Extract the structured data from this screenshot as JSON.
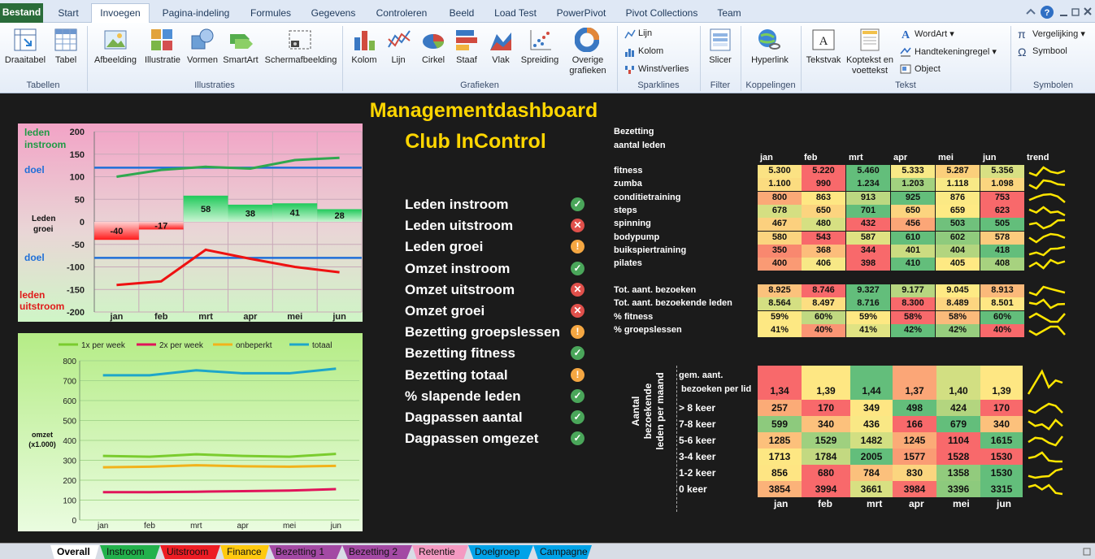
{
  "tabs": [
    "Bestand",
    "Start",
    "Invoegen",
    "Pagina-indeling",
    "Formules",
    "Gegevens",
    "Controleren",
    "Beeld",
    "Load Test",
    "PowerPivot",
    "Pivot Collections",
    "Team"
  ],
  "ribbon": {
    "buttons": [
      "Draaitabel",
      "Tabel",
      "Afbeelding",
      "Illustratie",
      "Vormen",
      "SmartArt",
      "Schermafbeelding",
      "Kolom",
      "Lijn",
      "Cirkel",
      "Staaf",
      "Vlak",
      "Spreiding",
      "Overige",
      "grafieken",
      "Slicer",
      "Hyperlink",
      "Tekstvak",
      "Koptekst en",
      "voettekst"
    ],
    "sparklines": [
      "Lijn",
      "Kolom",
      "Winst/verlies"
    ],
    "tekst_small": [
      "WordArt",
      "Handtekeningregel",
      "Object"
    ],
    "symbolen": [
      "Vergelijking",
      "Symbool"
    ],
    "groups": [
      "Tabellen",
      "Illustraties",
      "Grafieken",
      "Sparklines",
      "Filter",
      "Koppelingen",
      "Tekst",
      "Symbolen"
    ]
  },
  "dashboard": {
    "title1": "Managementdashboard",
    "title2": "Club InControl"
  },
  "kpis": [
    {
      "label": "Leden instroom",
      "status": "ok"
    },
    {
      "label": "Leden uitstroom",
      "status": "bad"
    },
    {
      "label": "Leden groei",
      "status": "warn"
    },
    {
      "label": "Omzet instroom",
      "status": "ok"
    },
    {
      "label": "Omzet uitstroom",
      "status": "bad"
    },
    {
      "label": "Omzet groei",
      "status": "bad"
    },
    {
      "label": "Bezetting groepslessen",
      "status": "warn"
    },
    {
      "label": "Bezetting fitness",
      "status": "ok"
    },
    {
      "label": "Bezetting totaal",
      "status": "warn"
    },
    {
      "label": "% slapende leden",
      "status": "ok"
    },
    {
      "label": "Dagpassen aantal",
      "status": "ok"
    },
    {
      "label": "Dagpassen omgezet",
      "status": "ok"
    }
  ],
  "chart_data": [
    {
      "type": "line",
      "categories": [
        "jan",
        "feb",
        "mrt",
        "apr",
        "mei",
        "jun"
      ],
      "labels": {
        "leden": "leden",
        "instroom": "instroom",
        "doel": "doel",
        "leden_groei_1": "Leden",
        "leden_groei_2": "groei",
        "uitstroom": "uitstroom"
      },
      "ylim": [
        -200,
        200
      ],
      "yticks": [
        "200",
        "150",
        "100",
        "50",
        "0",
        "-50",
        "-100",
        "-150",
        "-200"
      ],
      "series": [
        {
          "name": "leden instroom",
          "values": [
            100,
            115,
            122,
            118,
            137,
            142
          ]
        },
        {
          "name": "leden uitstroom",
          "values": [
            -140,
            -132,
            -62,
            -82,
            -100,
            -112
          ]
        },
        {
          "name": "doel",
          "values": [
            120,
            120,
            120,
            120,
            120,
            120
          ]
        },
        {
          "name": "doel",
          "values": [
            -80,
            -80,
            -80,
            -80,
            -80,
            -80
          ]
        },
        {
          "name": "groei",
          "values": [
            -40,
            -17,
            58,
            38,
            41,
            28
          ],
          "display": [
            "-40",
            "-17",
            "58",
            "38",
            "41",
            "28"
          ]
        }
      ],
      "colors": {
        "instroom": "#2fa84f",
        "uitstroom": "#ee1111",
        "doel": "#1f6fd8"
      }
    },
    {
      "type": "line",
      "categories": [
        "jan",
        "feb",
        "mrt",
        "apr",
        "mei",
        "jun"
      ],
      "ylabel": "omzet\n(x1.000)",
      "ylabel_lines": [
        "omzet",
        "(x1.000)"
      ],
      "ylim": [
        0,
        800
      ],
      "yticks": [
        "800",
        "700",
        "600",
        "500",
        "400",
        "300",
        "200",
        "100",
        "0"
      ],
      "series": [
        {
          "name": "1x per week",
          "values": [
            322,
            318,
            330,
            322,
            318,
            332
          ],
          "color": "#7acc2e"
        },
        {
          "name": "2x per week",
          "values": [
            140,
            140,
            142,
            145,
            148,
            155
          ],
          "color": "#e0145a"
        },
        {
          "name": "onbeperkt",
          "values": [
            265,
            268,
            275,
            270,
            268,
            272
          ],
          "color": "#f2b21b"
        },
        {
          "name": "totaal",
          "values": [
            727,
            727,
            752,
            737,
            737,
            760
          ],
          "color": "#1ea6c9"
        }
      ]
    },
    {
      "type": "table",
      "title1": "Bezetting",
      "title2": "aantal leden",
      "trend_header": "trend",
      "months": [
        "jan",
        "feb",
        "mrt",
        "apr",
        "mei",
        "jun"
      ],
      "rows": [
        {
          "label": "fitness",
          "values": [
            "5.300",
            "5.220",
            "5.460",
            "5.333",
            "5.287",
            "5.356"
          ],
          "colors": [
            "#fbe283",
            "#f8696b",
            "#63be7b",
            "#f8e986",
            "#fbcf7b",
            "#d8e083"
          ]
        },
        {
          "label": "zumba",
          "values": [
            "1.100",
            "990",
            "1.234",
            "1.203",
            "1.118",
            "1.098"
          ],
          "colors": [
            "#fbdc80",
            "#f8696b",
            "#63be7b",
            "#a2d17f",
            "#f8e986",
            "#fbd57f"
          ]
        },
        {
          "label": "conditietraining",
          "values": [
            "800",
            "863",
            "913",
            "925",
            "876",
            "753"
          ],
          "colors": [
            "#fba977",
            "#fee783",
            "#bcd881",
            "#63be7b",
            "#fbe984",
            "#f8696b"
          ]
        },
        {
          "label": "steps",
          "values": [
            "678",
            "650",
            "701",
            "650",
            "659",
            "623"
          ],
          "colors": [
            "#d5df82",
            "#fcd47f",
            "#63be7b",
            "#fcd47f",
            "#feea84",
            "#f8696b"
          ]
        },
        {
          "label": "spinning",
          "values": [
            "467",
            "480",
            "432",
            "456",
            "503",
            "505"
          ],
          "colors": [
            "#fcd07e",
            "#d6e082",
            "#f8696b",
            "#fba677",
            "#70c17c",
            "#63be7b"
          ]
        },
        {
          "label": "bodypump",
          "values": [
            "580",
            "543",
            "587",
            "610",
            "602",
            "578"
          ],
          "colors": [
            "#fbd47f",
            "#f8696b",
            "#dfe282",
            "#63be7b",
            "#8fcb7d",
            "#fbcb7d"
          ]
        },
        {
          "label": "buikspiertraining",
          "values": [
            "350",
            "368",
            "344",
            "401",
            "404",
            "418"
          ],
          "colors": [
            "#f9886f",
            "#fcbd7b",
            "#f8696b",
            "#cbdc81",
            "#b3d57f",
            "#63be7b"
          ]
        },
        {
          "label": "pilates",
          "values": [
            "400",
            "406",
            "398",
            "410",
            "405",
            "408"
          ],
          "colors": [
            "#fa9a74",
            "#f7e886",
            "#f8696b",
            "#63be7b",
            "#fee983",
            "#a7d27f"
          ]
        }
      ],
      "totals": [
        {
          "label": "Tot. aant.  bezoeken",
          "values": [
            "8.925",
            "8.746",
            "9.327",
            "9.177",
            "9.045",
            "8.913"
          ],
          "colors": [
            "#fbc27c",
            "#f8696b",
            "#63be7b",
            "#b7d680",
            "#feea84",
            "#fbb97a"
          ]
        },
        {
          "label": "Tot. aant. bezoekende leden",
          "values": [
            "8.564",
            "8.497",
            "8.716",
            "8.300",
            "8.489",
            "8.501"
          ],
          "colors": [
            "#d4df82",
            "#fcde81",
            "#63be7b",
            "#f8696b",
            "#fcd580",
            "#fee784"
          ]
        },
        {
          "label": "% fitness",
          "values": [
            "59%",
            "60%",
            "59%",
            "58%",
            "58%",
            "60%"
          ],
          "colors": [
            "#fde883",
            "#c0d981",
            "#fde883",
            "#f8696b",
            "#fbba7b",
            "#63be7b"
          ]
        },
        {
          "label": "% groepslessen",
          "values": [
            "41%",
            "40%",
            "41%",
            "42%",
            "42%",
            "40%"
          ],
          "colors": [
            "#fde883",
            "#fa9574",
            "#e0e383",
            "#63be7b",
            "#97cd7e",
            "#f8696b"
          ]
        }
      ]
    },
    {
      "type": "table",
      "side_label": [
        "Aantal",
        "bezoekende",
        "leden per maand"
      ],
      "months": [
        "jan",
        "feb",
        "mrt",
        "apr",
        "mei",
        "jun"
      ],
      "header_row": {
        "label1": "gem. aant.",
        "label2": "bezoeken per lid",
        "values": [
          "1,34",
          "1,39",
          "1,44",
          "1,37",
          "1,40",
          "1,39"
        ],
        "colors": [
          "#f8696b",
          "#fee783",
          "#63be7b",
          "#fba677",
          "#d2df82",
          "#fee783"
        ]
      },
      "rows": [
        {
          "label": "> 8 keer",
          "values": [
            "257",
            "170",
            "349",
            "498",
            "424",
            "170"
          ],
          "colors": [
            "#fbab77",
            "#f8696b",
            "#fee683",
            "#63be7b",
            "#b3d57f",
            "#f8696b"
          ]
        },
        {
          "label": "7-8 keer",
          "values": [
            "599",
            "340",
            "436",
            "166",
            "679",
            "340"
          ],
          "colors": [
            "#8dca7d",
            "#fcc17c",
            "#f9e885",
            "#f8696b",
            "#63be7b",
            "#fcc17c"
          ]
        },
        {
          "label": "5-6 keer",
          "values": [
            "1285",
            "1529",
            "1482",
            "1245",
            "1104",
            "1615"
          ],
          "colors": [
            "#fcc07b",
            "#9fd07f",
            "#d2df82",
            "#fbab77",
            "#f8696b",
            "#63be7b"
          ]
        },
        {
          "label": "3-4 keer",
          "values": [
            "1713",
            "1784",
            "2005",
            "1577",
            "1528",
            "1530"
          ],
          "colors": [
            "#fde783",
            "#c3d981",
            "#63be7b",
            "#fa9c74",
            "#f8696b",
            "#f86a6b"
          ]
        },
        {
          "label": "1-2 keer",
          "values": [
            "856",
            "680",
            "784",
            "830",
            "1358",
            "1530"
          ],
          "colors": [
            "#fee583",
            "#f8696b",
            "#fbc07c",
            "#fbd57f",
            "#92cb7d",
            "#63be7b"
          ]
        },
        {
          "label": "0 keer",
          "values": [
            "3854",
            "3994",
            "3661",
            "3984",
            "3396",
            "3315"
          ],
          "colors": [
            "#fbb279",
            "#f8696b",
            "#d8e082",
            "#f86f6c",
            "#8dca7d",
            "#63be7b"
          ]
        }
      ]
    }
  ],
  "sheet_tabs": [
    {
      "label": "Overall",
      "color": "#ffffff"
    },
    {
      "label": "Instroom",
      "color": "#22b14c"
    },
    {
      "label": "Uitstroom",
      "color": "#ed1c24"
    },
    {
      "label": "Finance",
      "color": "#ffc90e"
    },
    {
      "label": "Bezetting 1",
      "color": "#a349a4"
    },
    {
      "label": "Bezetting 2",
      "color": "#a349a4"
    },
    {
      "label": "Retentie",
      "color": "#f49ac2"
    },
    {
      "label": "Doelgroep",
      "color": "#00a2e8"
    },
    {
      "label": "Campagne",
      "color": "#00a2e8"
    }
  ]
}
